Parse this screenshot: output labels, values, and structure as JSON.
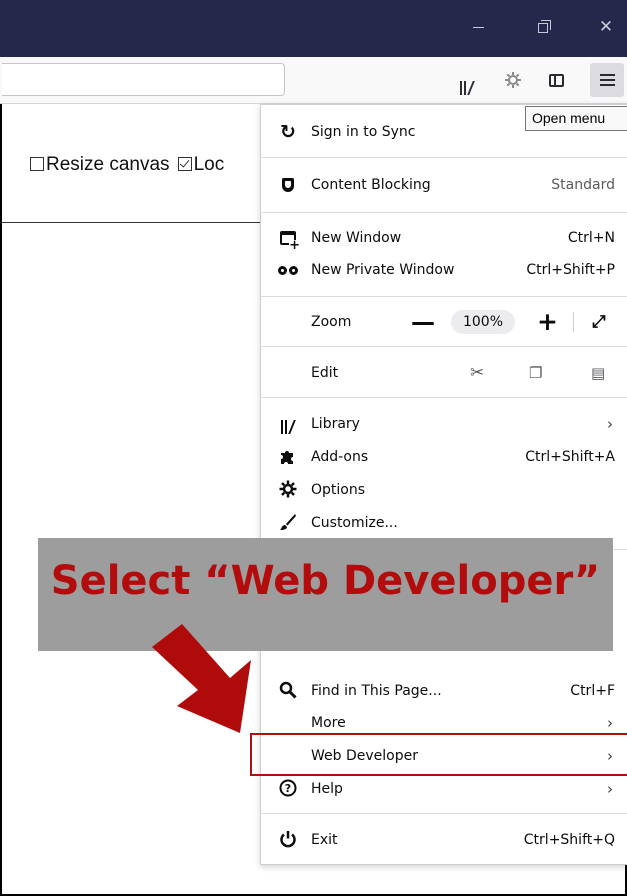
{
  "window": {
    "minimize_label": "—",
    "restore_label": "",
    "close_label": "✕"
  },
  "toolbar": {
    "url_value": "",
    "icons": [
      "library-icon",
      "sync-icon",
      "sidebar-icon",
      "menu-icon"
    ]
  },
  "tooltip": {
    "text": "Open menu"
  },
  "page": {
    "resize_canvas_label": "Resize canvas",
    "resize_canvas_checked": false,
    "lock_label": "Loc",
    "lock_checked": true
  },
  "menu": {
    "sign_in": "Sign in to Sync",
    "content_blocking": "Content Blocking",
    "content_blocking_value": "Standard",
    "new_window": "New Window",
    "new_window_shortcut": "Ctrl+N",
    "new_private_window": "New Private Window",
    "new_private_window_shortcut": "Ctrl+Shift+P",
    "zoom": "Zoom",
    "zoom_minus": "—",
    "zoom_level": "100%",
    "zoom_plus": "+",
    "edit": "Edit",
    "library": "Library",
    "addons": "Add-ons",
    "addons_shortcut": "Ctrl+Shift+A",
    "options": "Options",
    "customize": "Customize...",
    "find": "Find in This Page...",
    "find_shortcut": "Ctrl+F",
    "more": "More",
    "web_developer": "Web Developer",
    "help": "Help",
    "exit": "Exit",
    "exit_shortcut": "Ctrl+Shift+Q",
    "submenu_arrow": "›"
  },
  "annotation": {
    "banner_text": "Select “Web Developer”",
    "banner_color": "#9d9d9d",
    "text_color": "#b30c0c",
    "highlight_color": "#b50d0d"
  },
  "colors": {
    "titlebar": "#25284b",
    "toolbar": "#f9f9fa"
  }
}
